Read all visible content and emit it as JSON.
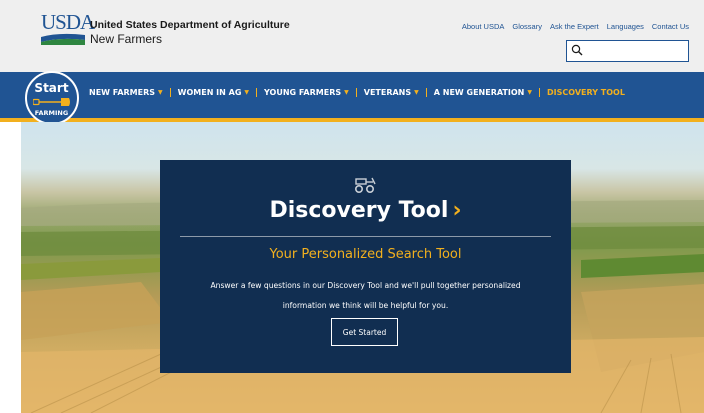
{
  "header": {
    "agency_abbr": "USDA",
    "agency_name": "United States Department of Agriculture",
    "site_name": "New Farmers",
    "utility_links": [
      "About USDA",
      "Glossary",
      "Ask the Expert",
      "Languages",
      "Contact Us"
    ],
    "search": {
      "placeholder": "",
      "value": "",
      "icon": "search-icon"
    }
  },
  "nav": {
    "logo": {
      "line1": "Start",
      "line2": "FARMING"
    },
    "items": [
      {
        "label": "NEW FARMERS",
        "has_menu": true
      },
      {
        "label": "WOMEN IN AG",
        "has_menu": true
      },
      {
        "label": "YOUNG FARMERS",
        "has_menu": true
      },
      {
        "label": "VETERANS",
        "has_menu": true
      },
      {
        "label": "A NEW GENERATION",
        "has_menu": true
      },
      {
        "label": "DISCOVERY TOOL",
        "has_menu": false,
        "active": true
      }
    ],
    "caret": "▼"
  },
  "hero": {
    "icon": "tractor-icon",
    "title": "Discovery Tool",
    "title_arrow": "›",
    "subtitle": "Your Personalized Search Tool",
    "body": "Answer a few questions in our Discovery Tool and we'll pull together personalized information we think will be helpful for you.",
    "button_label": "Get Started"
  },
  "colors": {
    "usda_blue": "#205493",
    "nav_blue": "#205493",
    "accent_gold": "#f2b01e",
    "card_navy": "#112e51",
    "header_gray": "#efefef"
  }
}
